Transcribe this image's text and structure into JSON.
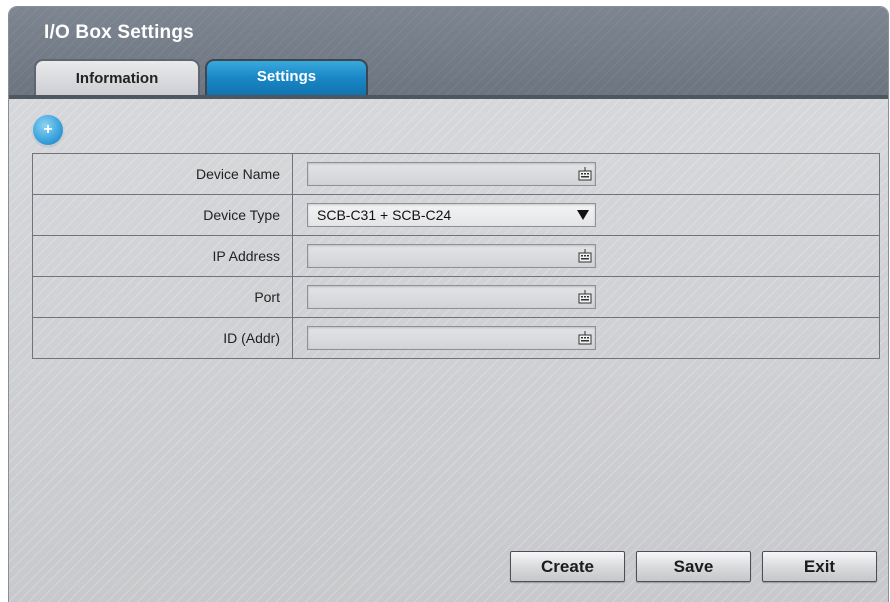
{
  "window": {
    "title": "I/O Box Settings"
  },
  "tabs": [
    {
      "label": "Information",
      "active": false
    },
    {
      "label": "Settings",
      "active": true
    }
  ],
  "add_button": {
    "symbol": "+"
  },
  "form": {
    "rows": [
      {
        "label": "Device Name",
        "type": "text",
        "value": "",
        "icon": "keyboard-icon"
      },
      {
        "label": "Device Type",
        "type": "select",
        "value": "SCB-C31 + SCB-C24",
        "icon": "dropdown-arrow-icon"
      },
      {
        "label": "IP Address",
        "type": "text",
        "value": "",
        "icon": "keyboard-icon"
      },
      {
        "label": "Port",
        "type": "text",
        "value": "",
        "icon": "keyboard-icon"
      },
      {
        "label": "ID (Addr)",
        "type": "text",
        "value": "",
        "icon": "keyboard-icon"
      }
    ]
  },
  "buttons": {
    "create": "Create",
    "save": "Save",
    "exit": "Exit"
  },
  "colors": {
    "accent": "#1987c6",
    "titlebar": "#6c7480",
    "panel": "#c8c9cc"
  }
}
